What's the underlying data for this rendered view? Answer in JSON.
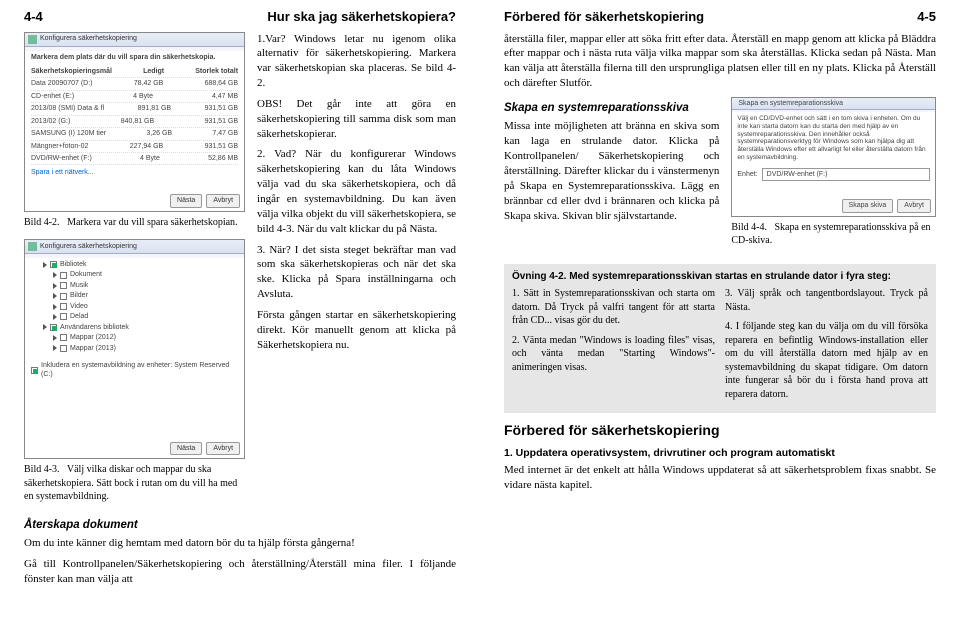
{
  "left": {
    "pageNum": "4-4",
    "headerTitle": "Hur ska jag säkerhetskopiera?",
    "fig42": {
      "fignum": "Bild 4-2.",
      "text": "Markera var du vill spara säkerhetskopian."
    },
    "fig43": {
      "fignum": "Bild 4-3.",
      "text": "Välj vilka diskar och mappar du ska säkerhetskopiera. Sätt bock i rutan om du vill ha med en systemavbildning."
    },
    "p1": "1.Var? Windows letar nu igenom olika alternativ för säkerhetskopiering. Markera var säkerhetskopian ska placeras. Se bild 4-2.",
    "p1b": "OBS! Det går inte att göra en säkerhetskopiering till samma disk som man säkerhetskopierar.",
    "p2": "2. Vad? När du konfigurerar Windows säkerhetskopiering kan du låta Windows välja vad du ska säkerhetskopiera, och då ingår en systemavbildning. Du kan även välja vilka objekt du vill säkerhetskopiera, se bild 4-3. När du valt klickar du på Nästa.",
    "p3": "3. När? I det sista steget bekräftar man vad som ska säkerhetskopieras och när det ska ske. Klicka på Spara inställningarna och Avsluta.",
    "p4": "Första gången startar en säkerhetskopiering direkt. Kör manuellt genom att klicka på Säkerhetskopiera nu.",
    "h_rest": "Återskapa dokument",
    "p5": "Om du inte känner dig hemtam med datorn bör du ta hjälp första gångerna!",
    "p6": "Gå till Kontrollpanelen/Säkerhetskopiering och återställning/Återställ mina filer. I följande fönster kan man välja att",
    "win1": {
      "title": "Konfigurera säkerhetskopiering",
      "desc": "Markera dem plats där du vill spara din säkerhetskopia.",
      "cols": [
        "Säkerhetskopieringsmål",
        "Ledigt",
        "Storlek totalt"
      ],
      "rows": [
        [
          "Data 20090707 (D:)",
          "78,42 GB",
          "688,64 GB"
        ],
        [
          "CD-enhet (E:)",
          "4 Byte",
          "4,47 MB"
        ],
        [
          "2013/08 (SMI) Data & fl",
          "891,81 GB",
          "931,51 GB"
        ],
        [
          "2013/02 (G:)",
          "840,81 GB",
          "931,51 GB"
        ],
        [
          "SAMSUNG (I) 120M tier",
          "3,26 GB",
          "7,47 GB"
        ],
        [
          "Mängner+foton-02",
          "227,94 GB",
          "931,51 GB"
        ],
        [
          "DVD/RW-enhet (F:)",
          "4 Byte",
          "52,86 MB"
        ]
      ],
      "link": "Spara i ett nätverk...",
      "btns": [
        "Nästa",
        "Avbryt"
      ]
    },
    "win2": {
      "title": "Konfigurera säkerhetskopiering",
      "items": [
        "Bibliotek",
        "Dokument",
        "Musik",
        "Bilder",
        "Video",
        "Delad",
        "Användarens bibliotek",
        "Mappar (2012)",
        "Mappar (2013)"
      ],
      "check": "Inkludera en systemavbildning av enheter: System Reserved (C:)",
      "btns": [
        "Nästa",
        "Avbryt"
      ]
    }
  },
  "right": {
    "pageNum": "4-5",
    "headerTitle": "Förbered för säkerhetskopiering",
    "p_cont": "återställa filer, mappar eller att söka fritt efter data. Återställ en mapp genom att klicka på Bläddra efter mappar och i nästa ruta välja vilka mappar som ska återställas. Klicka sedan på Nästa. Man kan välja att återställa filerna till den ursprungliga platsen eller till en ny plats. Klicka på Återställ och därefter Slutför.",
    "h_skapa": "Skapa en systemreparationsskiva",
    "p_skapa": "Missa inte möjligheten att bränna en skiva som kan laga en strulande dator. Klicka på Kontrollpanelen/ Säkerhetskopiering och återställning. Därefter klickar du i vänstermenyn på Skapa en Systemreparationsskiva. Lägg en brännbar cd eller dvd i brännaren och klicka på Skapa skiva. Skivan blir självstartande.",
    "fig44": {
      "fignum": "Bild 4-4.",
      "text": "Skapa en systemreparationsskiva på en CD-skiva."
    },
    "ex": {
      "head": "Övning 4-2.   Med systemreparationsskivan startas en strulande dator i fyra steg:",
      "s1": "1. Sätt in Systemreparationsskivan och starta om datorn. Då Tryck på valfri tangent för att starta från CD... visas gör du det.",
      "s2": "2. Vänta medan \"Windows is loading files\" visas, och vänta medan \"Starting Windows\"-animeringen visas.",
      "s3": "3. Välj språk och tangentbordslayout. Tryck på Nästa.",
      "s4": "4. I följande steg kan du välja om du vill försöka reparera en befintlig Windows-installation eller om du vill återställa datorn med hjälp av en systemavbildning du skapat tidigare. Om datorn inte fungerar så bör du i första hand prova att reparera datorn."
    },
    "h_for": "Förbered för säkerhetskopiering",
    "h_up": "1. Uppdatera operativsystem, drivrutiner och program automatiskt",
    "p_up": "Med internet är det enkelt att hålla Windows uppdaterat så att säkerhetsproblem fixas snabbt. Se vidare nästa kapitel.",
    "win3": {
      "title": "Skapa en systemreparationsskiva",
      "desc": "Välj en CD/DVD-enhet och sätt i en tom skiva i enheten. Om du inte kan starta datorn kan du starta den med hjälp av en systemreparationsskiva. Den innehåller också systemreparationsverktyg för Windows som kan hjälpa dig att återställa Windows efter ett allvarligt fel eller återställa datorn från en systemavbildning.",
      "label": "Enhet:",
      "sel": "DVD/RW-enhet (F:)",
      "btns": [
        "Skapa skiva",
        "Avbryt"
      ]
    }
  }
}
